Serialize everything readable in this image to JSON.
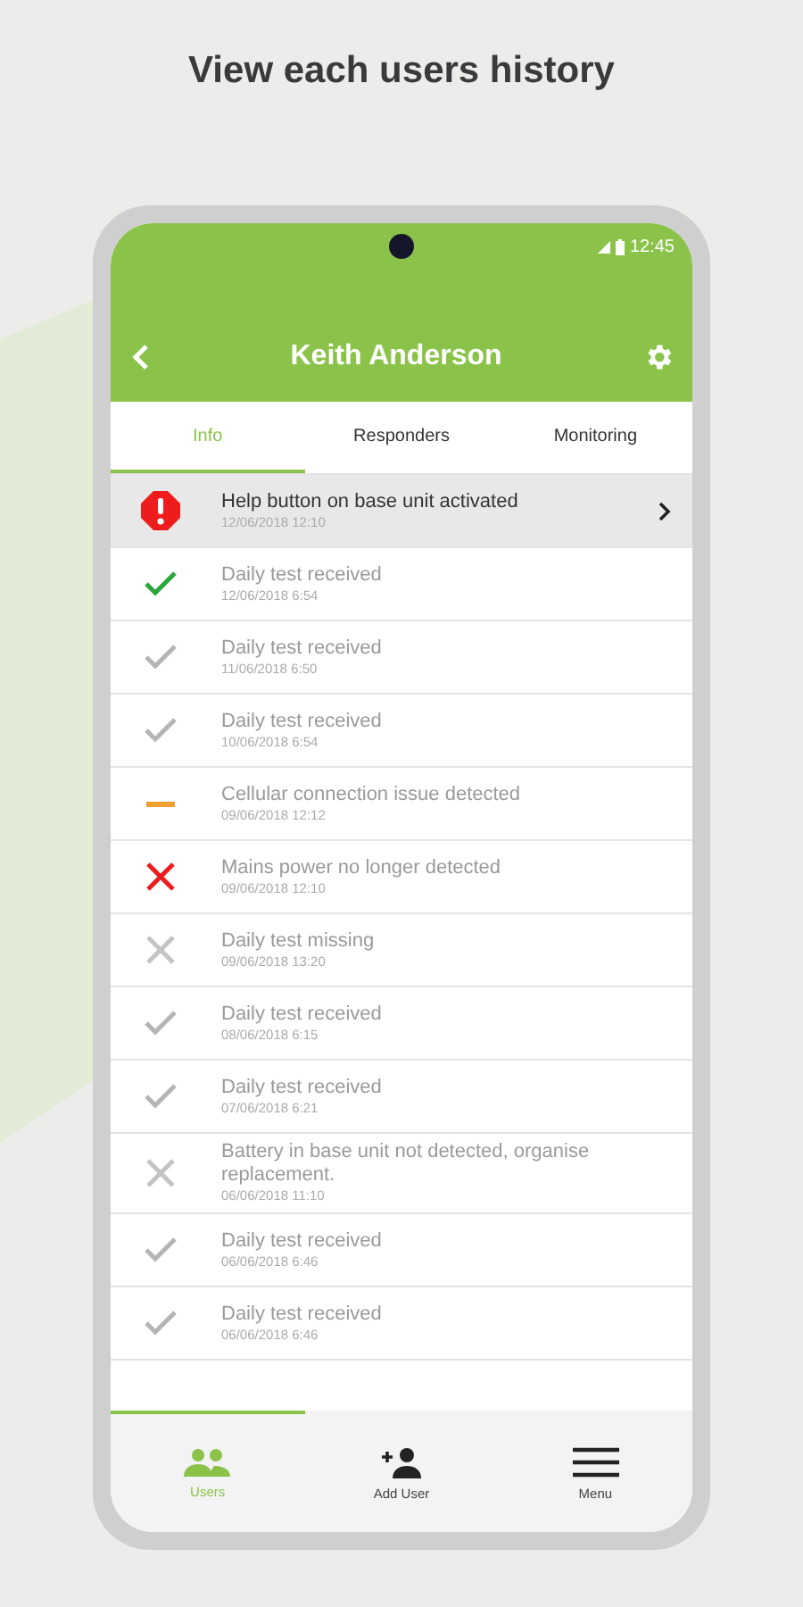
{
  "headline": "View each users history",
  "status_bar": {
    "time": "12:45"
  },
  "header": {
    "title": "Keith Anderson"
  },
  "tabs": [
    {
      "label": "Info",
      "selected": true
    },
    {
      "label": "Responders",
      "selected": false
    },
    {
      "label": "Monitoring",
      "selected": false
    }
  ],
  "events": [
    {
      "kind": "alert",
      "title": "Help button on base unit activated",
      "time": "12/06/2018 12:10",
      "selected": true,
      "color": "#ee1c1c"
    },
    {
      "kind": "check",
      "title": "Daily test received",
      "time": "12/06/2018 6:54",
      "selected": false,
      "color": "#2aa63a"
    },
    {
      "kind": "check",
      "title": "Daily test received",
      "time": "11/06/2018 6:50",
      "selected": false,
      "color": "#b5b5b5"
    },
    {
      "kind": "check",
      "title": "Daily test received",
      "time": "10/06/2018 6:54",
      "selected": false,
      "color": "#b5b5b5"
    },
    {
      "kind": "dash",
      "title": "Cellular connection issue detected",
      "time": "09/06/2018 12:12",
      "selected": false,
      "color": "#f0a030"
    },
    {
      "kind": "cross",
      "title": "Mains power no longer detected",
      "time": "09/06/2018 12:10",
      "selected": false,
      "color": "#ee1c1c"
    },
    {
      "kind": "cross",
      "title": "Daily test missing",
      "time": "09/06/2018 13:20",
      "selected": false,
      "color": "#c4c4c4"
    },
    {
      "kind": "check",
      "title": "Daily test received",
      "time": "08/06/2018 6:15",
      "selected": false,
      "color": "#b5b5b5"
    },
    {
      "kind": "check",
      "title": "Daily test received",
      "time": "07/06/2018 6:21",
      "selected": false,
      "color": "#b5b5b5"
    },
    {
      "kind": "cross",
      "title": "Battery in base unit not detected, organise replacement.",
      "time": "06/06/2018 11:10",
      "selected": false,
      "color": "#c4c4c4"
    },
    {
      "kind": "check",
      "title": "Daily test received",
      "time": "06/06/2018 6:46",
      "selected": false,
      "color": "#b5b5b5"
    },
    {
      "kind": "check",
      "title": "Daily test received",
      "time": "06/06/2018 6:46",
      "selected": false,
      "color": "#b5b5b5"
    }
  ],
  "bottom_nav": [
    {
      "kind": "users",
      "label": "Users",
      "selected": true
    },
    {
      "kind": "add_user",
      "label": "Add User",
      "selected": false
    },
    {
      "kind": "menu",
      "label": "Menu",
      "selected": false
    }
  ]
}
